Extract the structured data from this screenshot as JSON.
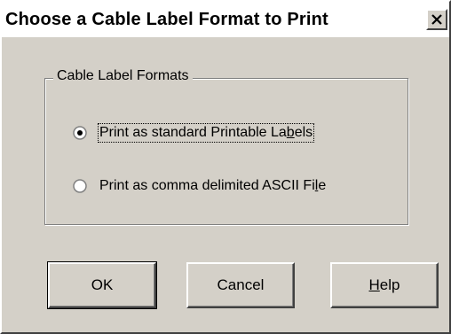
{
  "window": {
    "title": "Choose a Cable Label Format to Print",
    "close_icon": "close-icon"
  },
  "group": {
    "label": "Cable Label Formats"
  },
  "options": [
    {
      "label_pre": "Print as standard Printable La",
      "label_mnemonic": "b",
      "label_post": "els",
      "selected": true
    },
    {
      "label_pre": "Print as comma delimited ASCII Fi",
      "label_mnemonic": "l",
      "label_post": "e",
      "selected": false
    }
  ],
  "buttons": {
    "ok": "OK",
    "cancel": "Cancel",
    "help_mnemonic": "H",
    "help_rest": "elp"
  }
}
